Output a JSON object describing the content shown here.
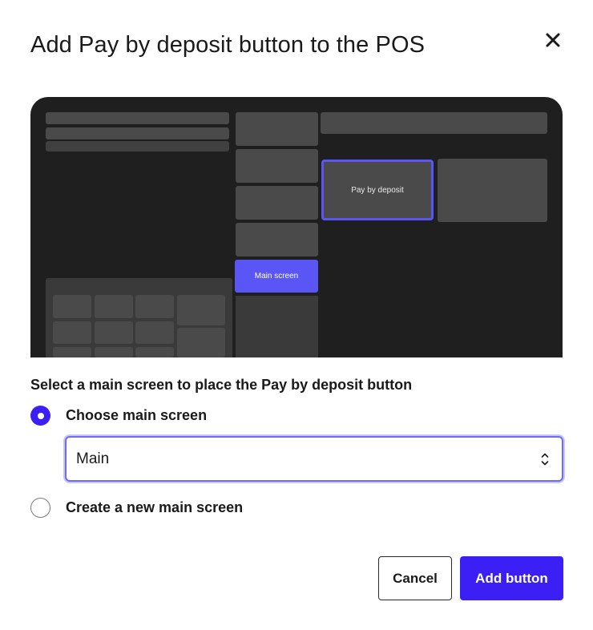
{
  "dialog": {
    "title": "Add Pay by deposit button to the POS",
    "close_icon": "close-icon"
  },
  "preview": {
    "deposit_tile_label": "Pay by deposit",
    "main_screen_tile_label": "Main screen",
    "accent_color": "#5a56f5"
  },
  "form": {
    "section_label": "Select a main screen to place the Pay by deposit button",
    "option_choose": {
      "label": "Choose main screen",
      "selected": true
    },
    "select_value": "Main",
    "option_create": {
      "label": "Create a new main screen",
      "selected": false
    }
  },
  "footer": {
    "cancel_label": "Cancel",
    "add_label": "Add button"
  },
  "colors": {
    "primary": "#3b1ff5",
    "focus_ring": "#6f6bf8"
  }
}
